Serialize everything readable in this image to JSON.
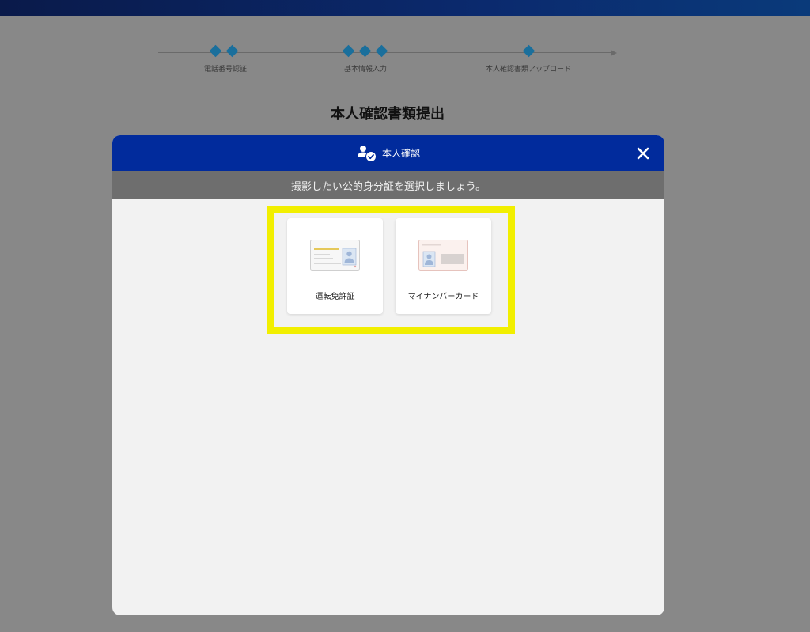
{
  "stepper": {
    "steps": [
      {
        "label": "電話番号認証"
      },
      {
        "label": "基本情報入力"
      },
      {
        "label": "本人確認書類アップロード"
      }
    ]
  },
  "page": {
    "title": "本人確認書類提出"
  },
  "modal": {
    "title": "本人確認",
    "close_icon": "close-icon",
    "subtitle": "撮影したい公的身分証を選択しましょう。",
    "options": [
      {
        "label": "運転免許証",
        "icon": "drivers-license-icon"
      },
      {
        "label": "マイナンバーカード",
        "icon": "my-number-card-icon"
      }
    ]
  },
  "colors": {
    "header": "#012b9c",
    "highlight": "#f2ef00",
    "step_diamond": "#1a6f9c"
  }
}
